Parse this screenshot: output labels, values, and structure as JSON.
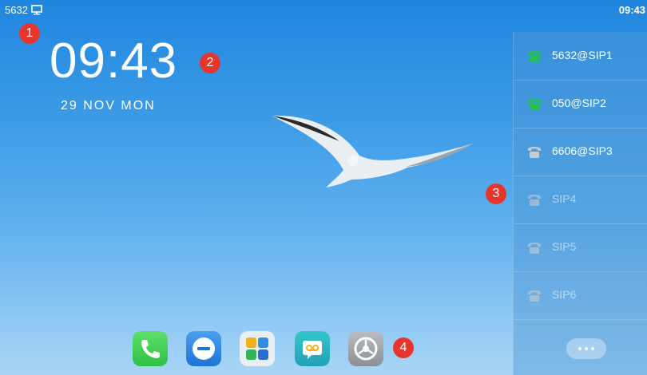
{
  "status": {
    "extension": "5632",
    "time": "09:43"
  },
  "home": {
    "clock": "09:43",
    "date": "29 NOV MON"
  },
  "accounts": [
    {
      "label": "5632@SIP1",
      "state": "registered"
    },
    {
      "label": "050@SIP2",
      "state": "registered"
    },
    {
      "label": "6606@SIP3",
      "state": "idle"
    },
    {
      "label": "SIP4",
      "state": "disabled"
    },
    {
      "label": "SIP5",
      "state": "disabled"
    },
    {
      "label": "SIP6",
      "state": "disabled"
    }
  ],
  "markers": [
    "1",
    "2",
    "3",
    "4"
  ],
  "dock": [
    {
      "icon": "phone-app-icon"
    },
    {
      "icon": "directory-app-icon"
    },
    {
      "icon": "applications-app-icon"
    },
    {
      "icon": "voicemail-app-icon"
    },
    {
      "icon": "settings-app-icon"
    }
  ],
  "colors": {
    "registered": "#22c44a",
    "idle": "#c8cbd0",
    "marker": "#e8352c"
  }
}
